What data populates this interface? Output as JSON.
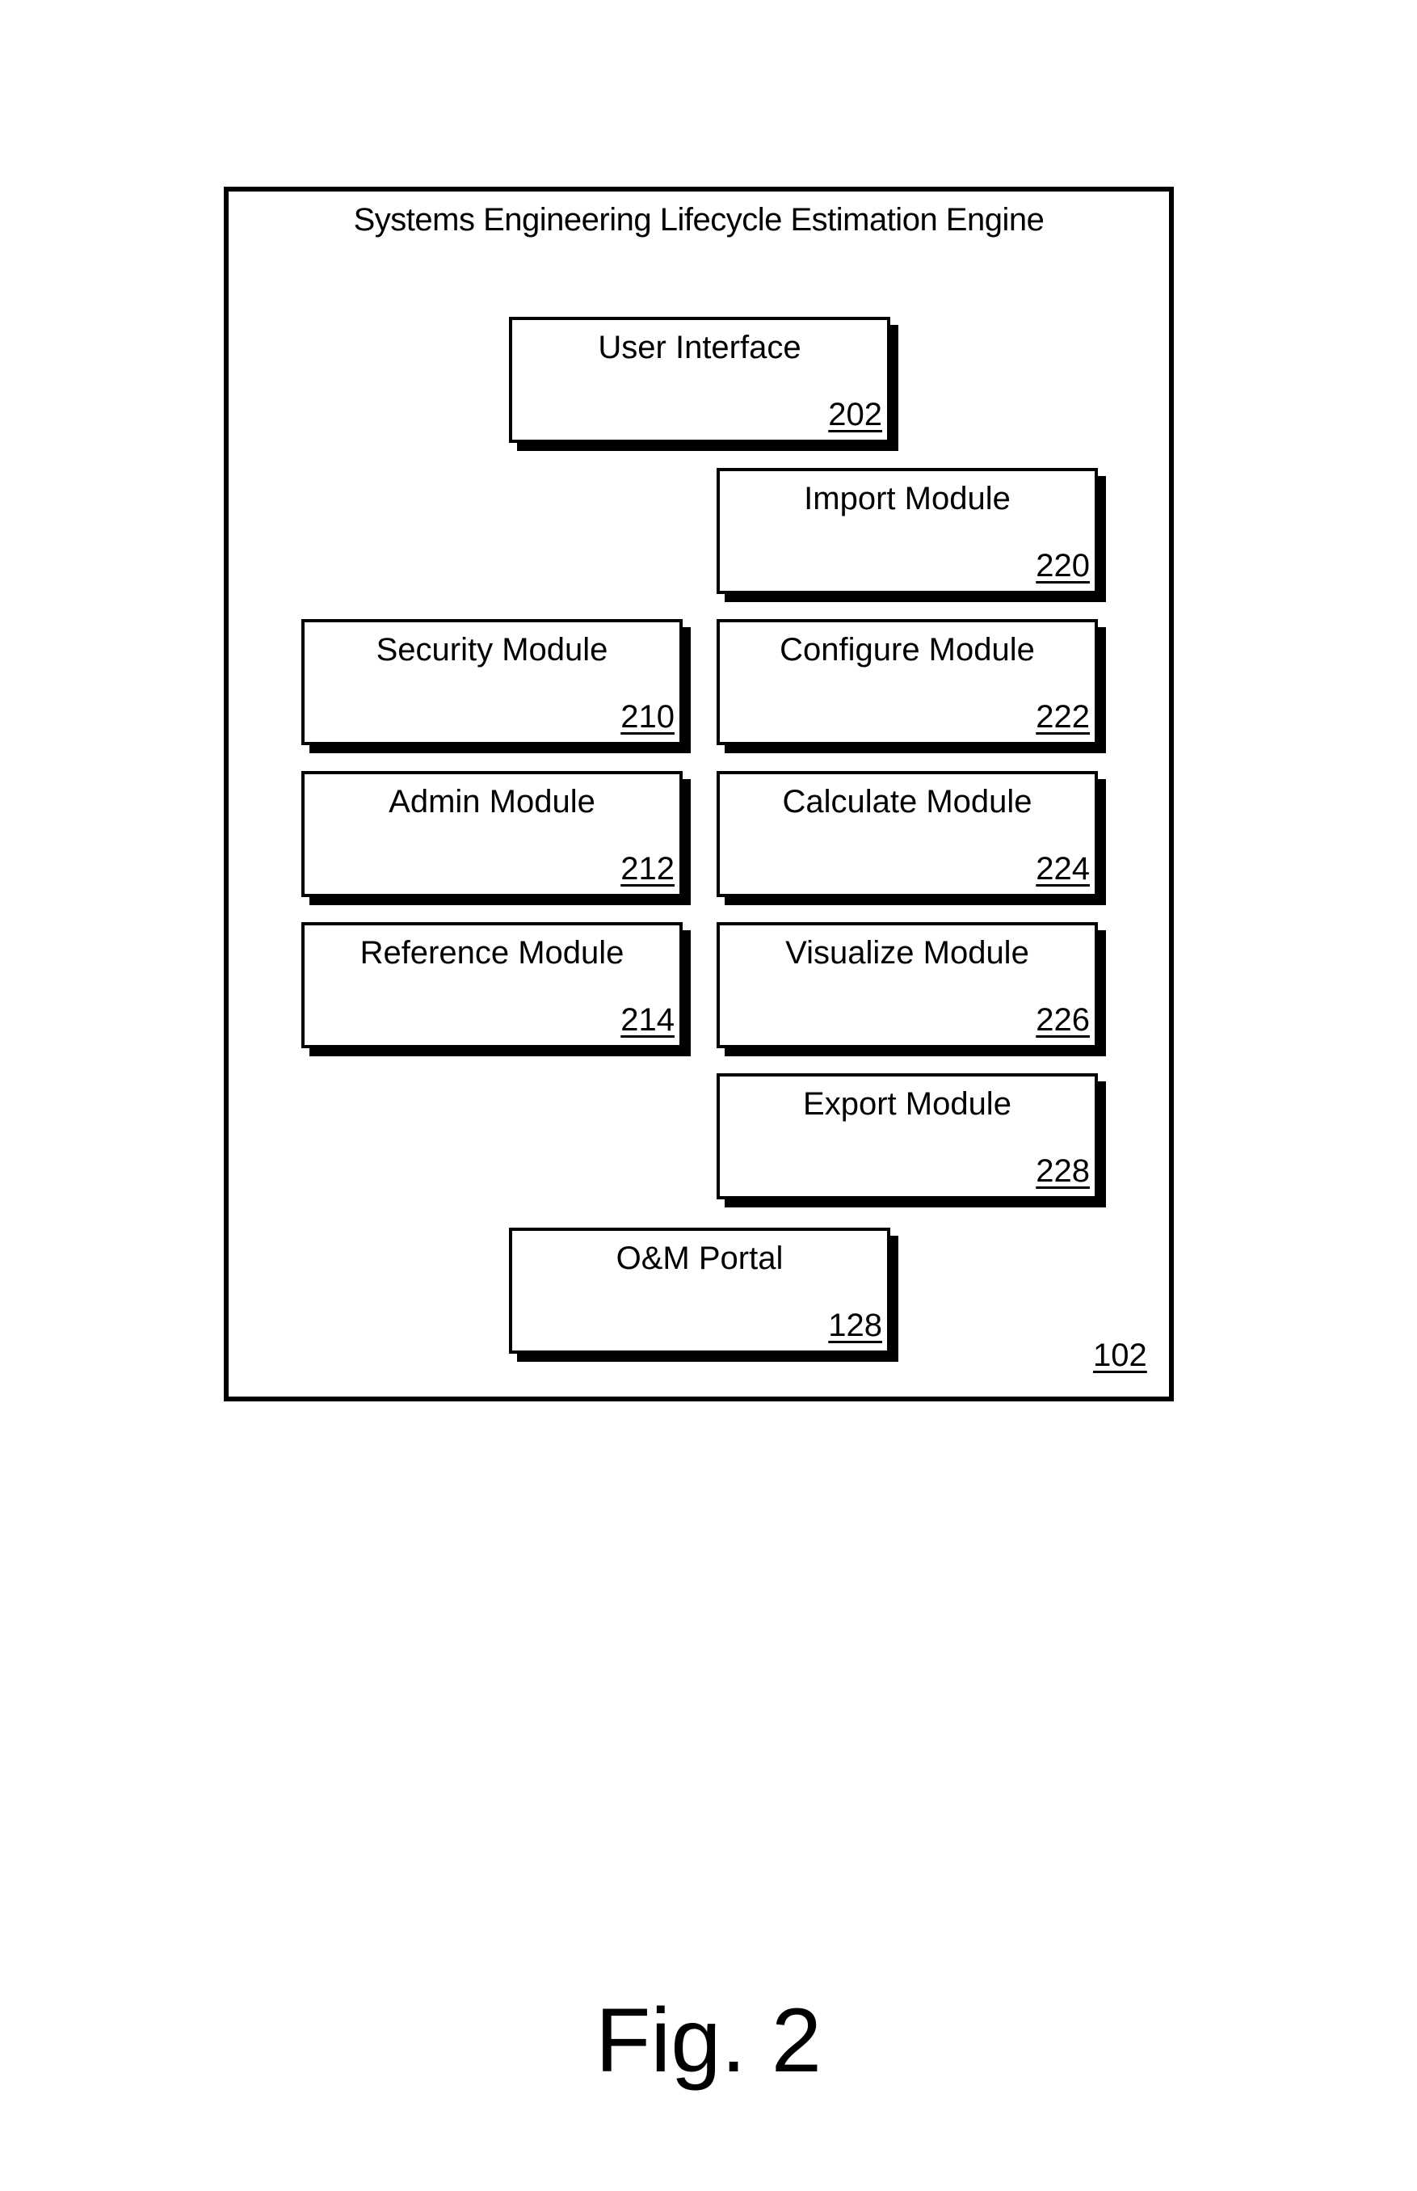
{
  "diagram": {
    "title": "Systems Engineering Lifecycle Estimation Engine",
    "frame_ref": "102",
    "figure_label": "Fig. 2",
    "boxes": {
      "user_interface": {
        "label": "User Interface",
        "ref": "202"
      },
      "import": {
        "label": "Import Module",
        "ref": "220"
      },
      "security": {
        "label": "Security Module",
        "ref": "210"
      },
      "configure": {
        "label": "Configure Module",
        "ref": "222"
      },
      "admin": {
        "label": "Admin Module",
        "ref": "212"
      },
      "calculate": {
        "label": "Calculate Module",
        "ref": "224"
      },
      "reference": {
        "label": "Reference Module",
        "ref": "214"
      },
      "visualize": {
        "label": "Visualize Module",
        "ref": "226"
      },
      "export": {
        "label": "Export Module",
        "ref": "228"
      },
      "om_portal": {
        "label": "O&M Portal",
        "ref": "128"
      }
    }
  }
}
